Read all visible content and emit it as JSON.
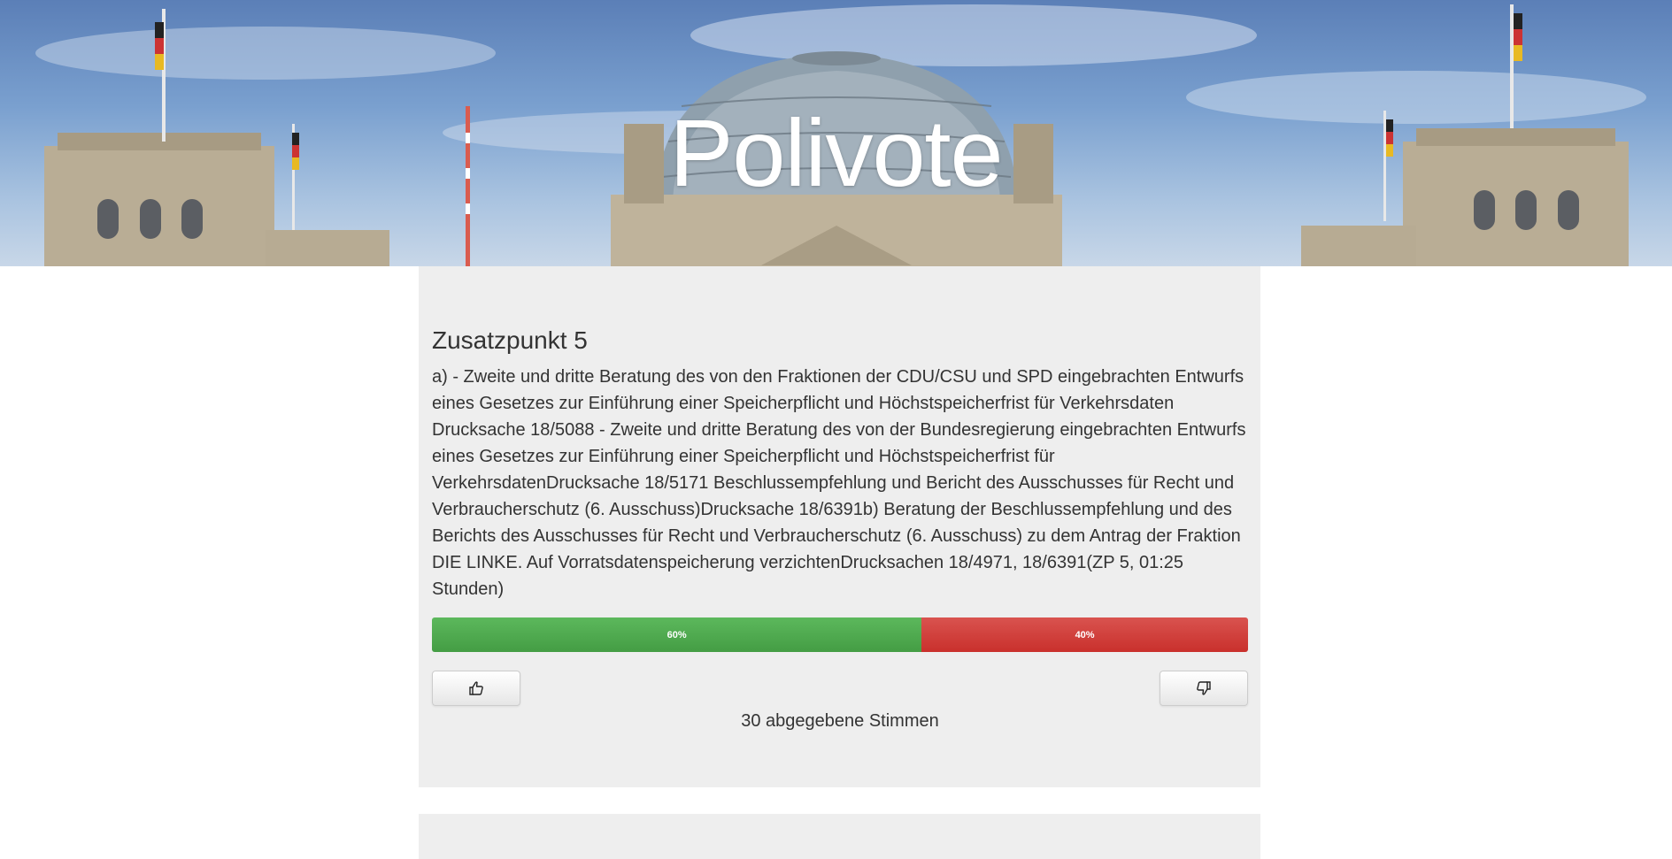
{
  "header": {
    "site_title": "Polivote"
  },
  "agenda_item": {
    "title": "Zusatzpunkt 5",
    "description": "a) - Zweite und dritte Beratung des von den Fraktionen der CDU/CSU und SPD eingebrachten Entwurfs eines Gesetzes zur Einführung einer Speicherpflicht und Höchstspeicherfrist für Verkehrsdaten Drucksache 18/5088 - Zweite und dritte Beratung des von der Bundesregierung eingebrachten Entwurfs eines Gesetzes zur Einführung einer Speicherpflicht und Höchstspeicherfrist für VerkehrsdatenDrucksache 18/5171 Beschlussempfehlung und Bericht des Ausschusses für Recht und Verbraucherschutz (6. Ausschuss)Drucksache 18/6391b) Beratung der Beschlussempfehlung und des Berichts des Ausschusses für Recht und Verbraucherschutz (6. Ausschuss) zu dem Antrag der Fraktion DIE LINKE. Auf Vorratsdatenspeicherung verzichtenDrucksachen 18/4971, 18/6391(ZP 5, 01:25 Stunden)",
    "result": {
      "yes_percent": 60,
      "no_percent": 40,
      "yes_label": "60%",
      "no_label": "40%"
    },
    "buttons": {
      "upvote_icon": "thumbs-up-icon",
      "downvote_icon": "thumbs-down-icon"
    },
    "votes_count_label": "30 abgegebene Stimmen"
  },
  "colors": {
    "yes": "#5cb85c",
    "no": "#d9534f",
    "card_background": "#eeeeee"
  }
}
